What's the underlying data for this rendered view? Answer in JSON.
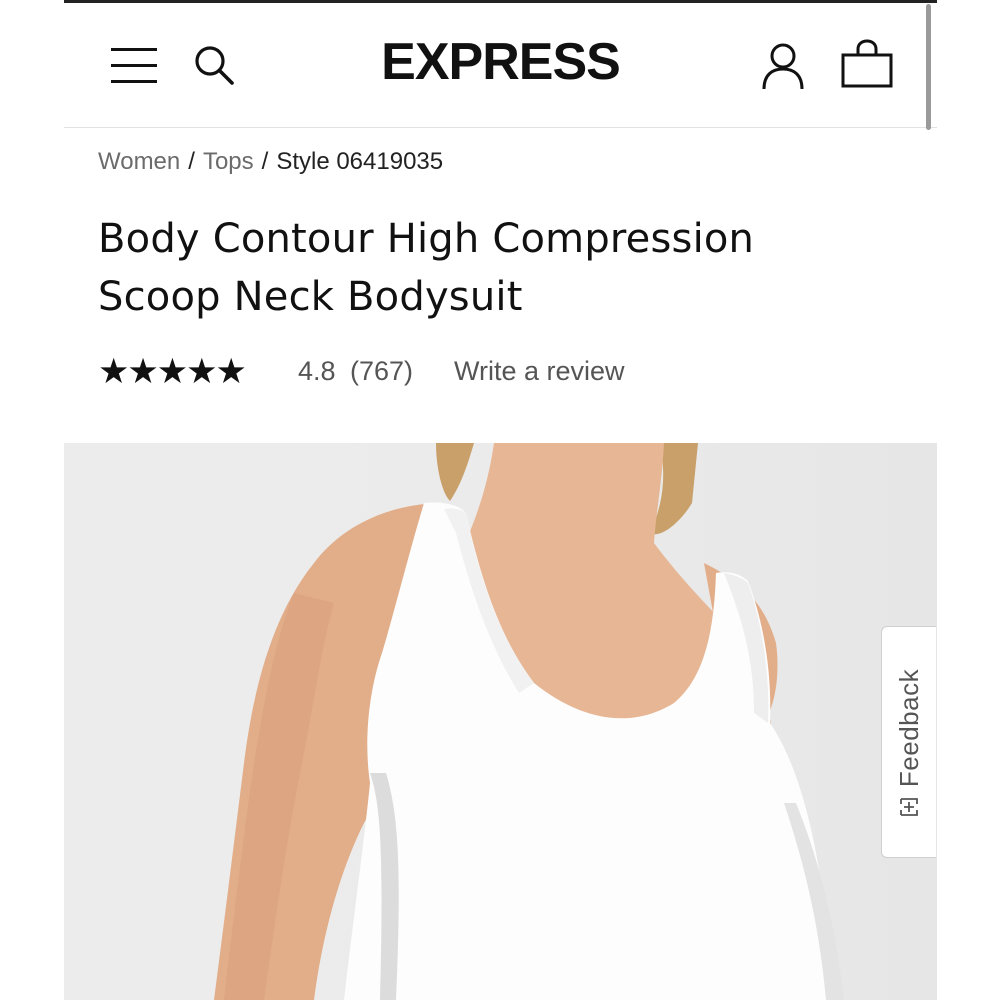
{
  "header": {
    "logo": "EXPRESS",
    "icons": {
      "menu": "hamburger-menu-icon",
      "search": "search-icon",
      "account": "account-icon",
      "bag": "shopping-bag-icon"
    }
  },
  "breadcrumb": {
    "items": [
      "Women",
      "Tops"
    ],
    "current": "Style 06419035",
    "separator": "/"
  },
  "product": {
    "title": "Body Contour High Compression Scoop Neck Bodysuit",
    "stars": "★★★★★",
    "rating": "4.8",
    "review_count": "(767)",
    "write_review": "Write a review"
  },
  "feedback": {
    "label": "Feedback",
    "icon": "feedback-plus-icon"
  },
  "colors": {
    "text_primary": "#111111",
    "text_muted": "#6b6b6b",
    "image_background": "#ececec"
  }
}
